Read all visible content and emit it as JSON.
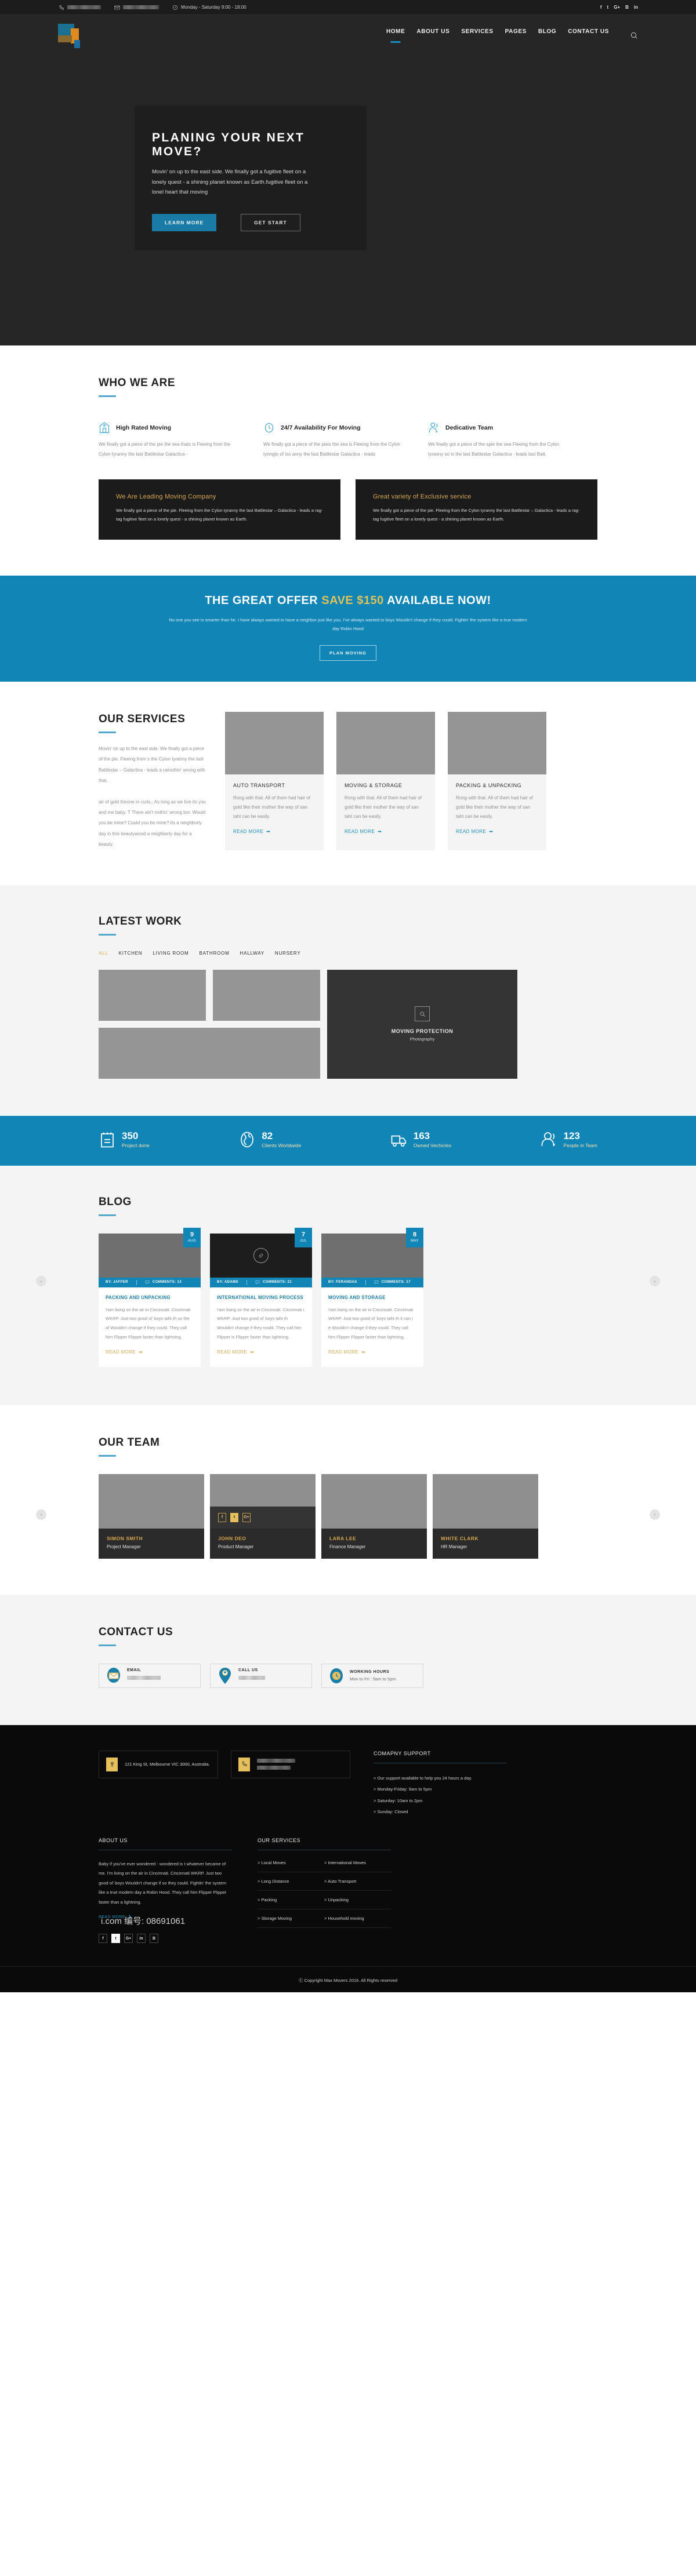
{
  "topbar": {
    "phone_icon": "phone-icon",
    "phone_value": "",
    "email_icon": "envelope-icon",
    "email_value": "",
    "hours_icon": "clock-icon",
    "hours": "Monday - Saturday 9:00 - 18:00",
    "social": [
      "f",
      "t",
      "G+",
      "B",
      "in"
    ]
  },
  "nav": {
    "logo_alt": "max-movers-logo",
    "items": [
      {
        "label": "HOME",
        "active": true
      },
      {
        "label": "ABOUT US",
        "active": false
      },
      {
        "label": "SERVICES",
        "active": false
      },
      {
        "label": "PAGES",
        "active": false
      },
      {
        "label": "BLOG",
        "active": false
      },
      {
        "label": "CONTACT US",
        "active": false
      }
    ],
    "search_icon": "search-icon"
  },
  "hero": {
    "title": "PLANING YOUR NEXT MOVE?",
    "body": "Movin' on up to the east side. We finally got a fugitive fleet on a lonely quest - a shining planet known as Earth.fugitive fleet on a lonel heart that moving",
    "primary_btn": "LEARN MORE",
    "secondary_btn": "GET START"
  },
  "who": {
    "title": "WHO WE ARE",
    "features": [
      {
        "icon": "home-badge-icon",
        "title": "High Rated  Moving",
        "body": "We finally got a piece of the pie the sea  thats is Fleeing from the Cylon tyranny the last Battlestar Galactica -"
      },
      {
        "icon": "clock-icon",
        "title": "24/7 Availability For Moving",
        "body": "We finally got a piece of the pieis  the sea is   Fleeing from the Cylon  tyringto of iso anny the last Battlestar Galactica - leads"
      },
      {
        "icon": "team-icon",
        "title": "Dedicative Team",
        "body": "We finally got a piece of the spie the sea Fleeing from the Cylon tyranny  so  is the last Battlestar Galactica - leads  last Batt."
      }
    ],
    "panels": [
      {
        "title": "We Are Leading Moving Company",
        "body": "We finally got a piece of the pie. Fleeing from the Cylon tyranny the last Battlestar – Galactica - leads a rag-tag fugitive fleet on a lonely quest - a shining planet known as Earth."
      },
      {
        "title": "Great variety of Exclusive service",
        "body": "We finally got a piece of the pie. Fleeing from the Cylon tyranny the last Battlestar – Galactica - leads a rag-tag fugitive fleet on a lonely quest - a shining planet known as Earth."
      }
    ]
  },
  "offer": {
    "pre": "THE GREAT OFFER ",
    "highlight": "SAVE $150",
    "post": " AVAILABLE NOW!",
    "body": "No one you see is smarter than he. I have always wanted to have a neighbor just like you. I've always wanted to  boys Wouldn't change if they could. Fightin' the system like a true modern day Robin Hood",
    "button": "PLAN MOVING"
  },
  "services": {
    "title": "OUR SERVICES",
    "intro_1": "Movin' on up to the east side. We finally got a piece of the pie. Fleeing from s the Cylon tyranny the last Battlestar – Galactica - leads a rainothin' wrong with that.",
    "intro_2": " air of gold  theone in curls.; As long as we live its you and me baby. T There ain't nothin' wrong bor. Would you be mine? Could you be mine? Its a neighborly day in this beautywood a neighborly day for a beauty.",
    "cards": [
      {
        "title": "AUTO TRANSPORT",
        "body": "Rong with that. All of them had hair of gold like their mother the way of san taht can be easily.",
        "link": "READ MORE"
      },
      {
        "title": "MOVING & STORAGE",
        "body": "Rong with that. All of them had hair of gold like their mother the way of san taht can be easily.",
        "link": "READ MORE"
      },
      {
        "title": "PACKING & UNPACKING",
        "body": "Rong with that. All of them had hair of gold like their mother the way of san taht can be easily.",
        "link": "READ MORE"
      }
    ]
  },
  "work": {
    "title": "LATEST WORK",
    "filters": [
      {
        "label": "ALL",
        "active": true
      },
      {
        "label": "KITCHEN",
        "active": false
      },
      {
        "label": "LIVING ROOM",
        "active": false
      },
      {
        "label": "BATHROOM",
        "active": false
      },
      {
        "label": "HALLWAY",
        "active": false
      },
      {
        "label": "NURSERY",
        "active": false
      }
    ],
    "feature": {
      "icon": "magnifier-icon",
      "title": "MOVING PROTECTION",
      "subtitle": "Photography"
    }
  },
  "stats": [
    {
      "icon": "clipboard-icon",
      "value": "350",
      "label": "Project done"
    },
    {
      "icon": "globe-icon",
      "value": "82",
      "label": "Clients Worldwide"
    },
    {
      "icon": "truck-icon",
      "value": "163",
      "label": "Owned Vechicles"
    },
    {
      "icon": "people-icon",
      "value": "123",
      "label": "People in Team"
    }
  ],
  "blog": {
    "title": "BLOG",
    "prev_icon": "chevron-left-icon",
    "next_icon": "chevron-right-icon",
    "posts": [
      {
        "day": "9",
        "month": "AUG",
        "by": "BY: JAFFER",
        "comments": "COMMENTS: 13",
        "title": "PACKING AND UNPACKING",
        "body": "I'am living on the air in Cincinnati. Cincinnati WKRP. Just two good ol' boys taht th so the of Wouldn't change if they could.  They call him Flipper Flipper faster than lightning.",
        "link": "READ MORE",
        "media": "image"
      },
      {
        "day": "7",
        "month": "JUL",
        "by": "BY: ADAMS",
        "comments": "COMMENTS: 21",
        "title": "INTERNATIONAL MOVING PROCESS",
        "body": "I'am living on the air in Cincinnati. Cincinnati i WKRP. Just two good ol' boys taht th Wouldn't change if they could.  They call him Flipper is Flipper faster than lightning.",
        "link": "READ MORE",
        "media": "video"
      },
      {
        "day": "8",
        "month": "MAY",
        "by": "BY: FERANDAS",
        "comments": "COMMENTS: 17",
        "title": "MOVING AND STORAGE",
        "body": "I'am living on the air in Cincinnati. Cincinnati WKRP. Just two good ol' boys taht th it can i e Wouldn't change if they could.  They call him Flipper Flipper faster than lightning.",
        "link": "READ MORE",
        "media": "image"
      }
    ]
  },
  "team": {
    "title": "OUR TEAM",
    "prev_icon": "chevron-left-icon",
    "next_icon": "chevron-right-icon",
    "members": [
      {
        "name": "SIMON SMITH",
        "role": "Project Manager",
        "social_open": false
      },
      {
        "name": "JOHN DEO",
        "role": "Product Manager",
        "social_open": true
      },
      {
        "name": "LARA LEE",
        "role": "Finance Manager",
        "social_open": false
      },
      {
        "name": "WHITE CLARK",
        "role": "HR Manager",
        "social_open": false
      }
    ],
    "social_icons": [
      "f",
      "t",
      "G+"
    ]
  },
  "contact": {
    "title": "CONTACT US",
    "cards": [
      {
        "icon": "envelope-pin-icon",
        "label": "EMAIL",
        "value": ""
      },
      {
        "icon": "person-pin-icon",
        "label": "CALL US",
        "value": ""
      },
      {
        "icon": "clock-badge-icon",
        "label": "WORKING HOURS",
        "value": "Mon to Fri : 9am to 5pm"
      }
    ]
  },
  "footer": {
    "address_icon": "location-icon",
    "address": "121 King St, Melbourne VIC 3000, Australia.",
    "phone_icon": "phone-icon",
    "phone": "",
    "support": {
      "title": "COMAPNY SUPPORT",
      "items": [
        "Our support available to help you 24 hours a day.",
        "Monday-Friday: 9am to 5pm",
        "Saturday: 10am to 2pm",
        "Sunday: Closed"
      ]
    },
    "about": {
      "title": "ABOUT US",
      "body": "Baby if you've ever wondered - wondered is t whatever became of me. I'm living on the air in Cincinnati. Cincinnati WKRP. Just two good ol' boys Wouldn't change if so they could. Fightin' the system like a true modern day a Robin Hood. They call him Flipper Flipper faster than a lightning.",
      "link": "READ MORE"
    },
    "services": {
      "title": "OUR SERVICES",
      "items": [
        "Local Moves",
        "International Moves",
        "Long Distance",
        "Auto Transport",
        "Packing",
        "Unpacking",
        "Storage Moving",
        "Household moving"
      ]
    },
    "social": [
      "f",
      "t",
      "G+",
      "in",
      "B"
    ],
    "copyright": "Ⓒ Copyright Max Movers 2016. All Rights reserved",
    "watermark": "i.com  编号: 08691061"
  },
  "colors": {
    "accent_blue": "#1185b5",
    "accent_gold": "#d6a850",
    "dark": "#262626",
    "near_black": "#0a0a0a"
  }
}
